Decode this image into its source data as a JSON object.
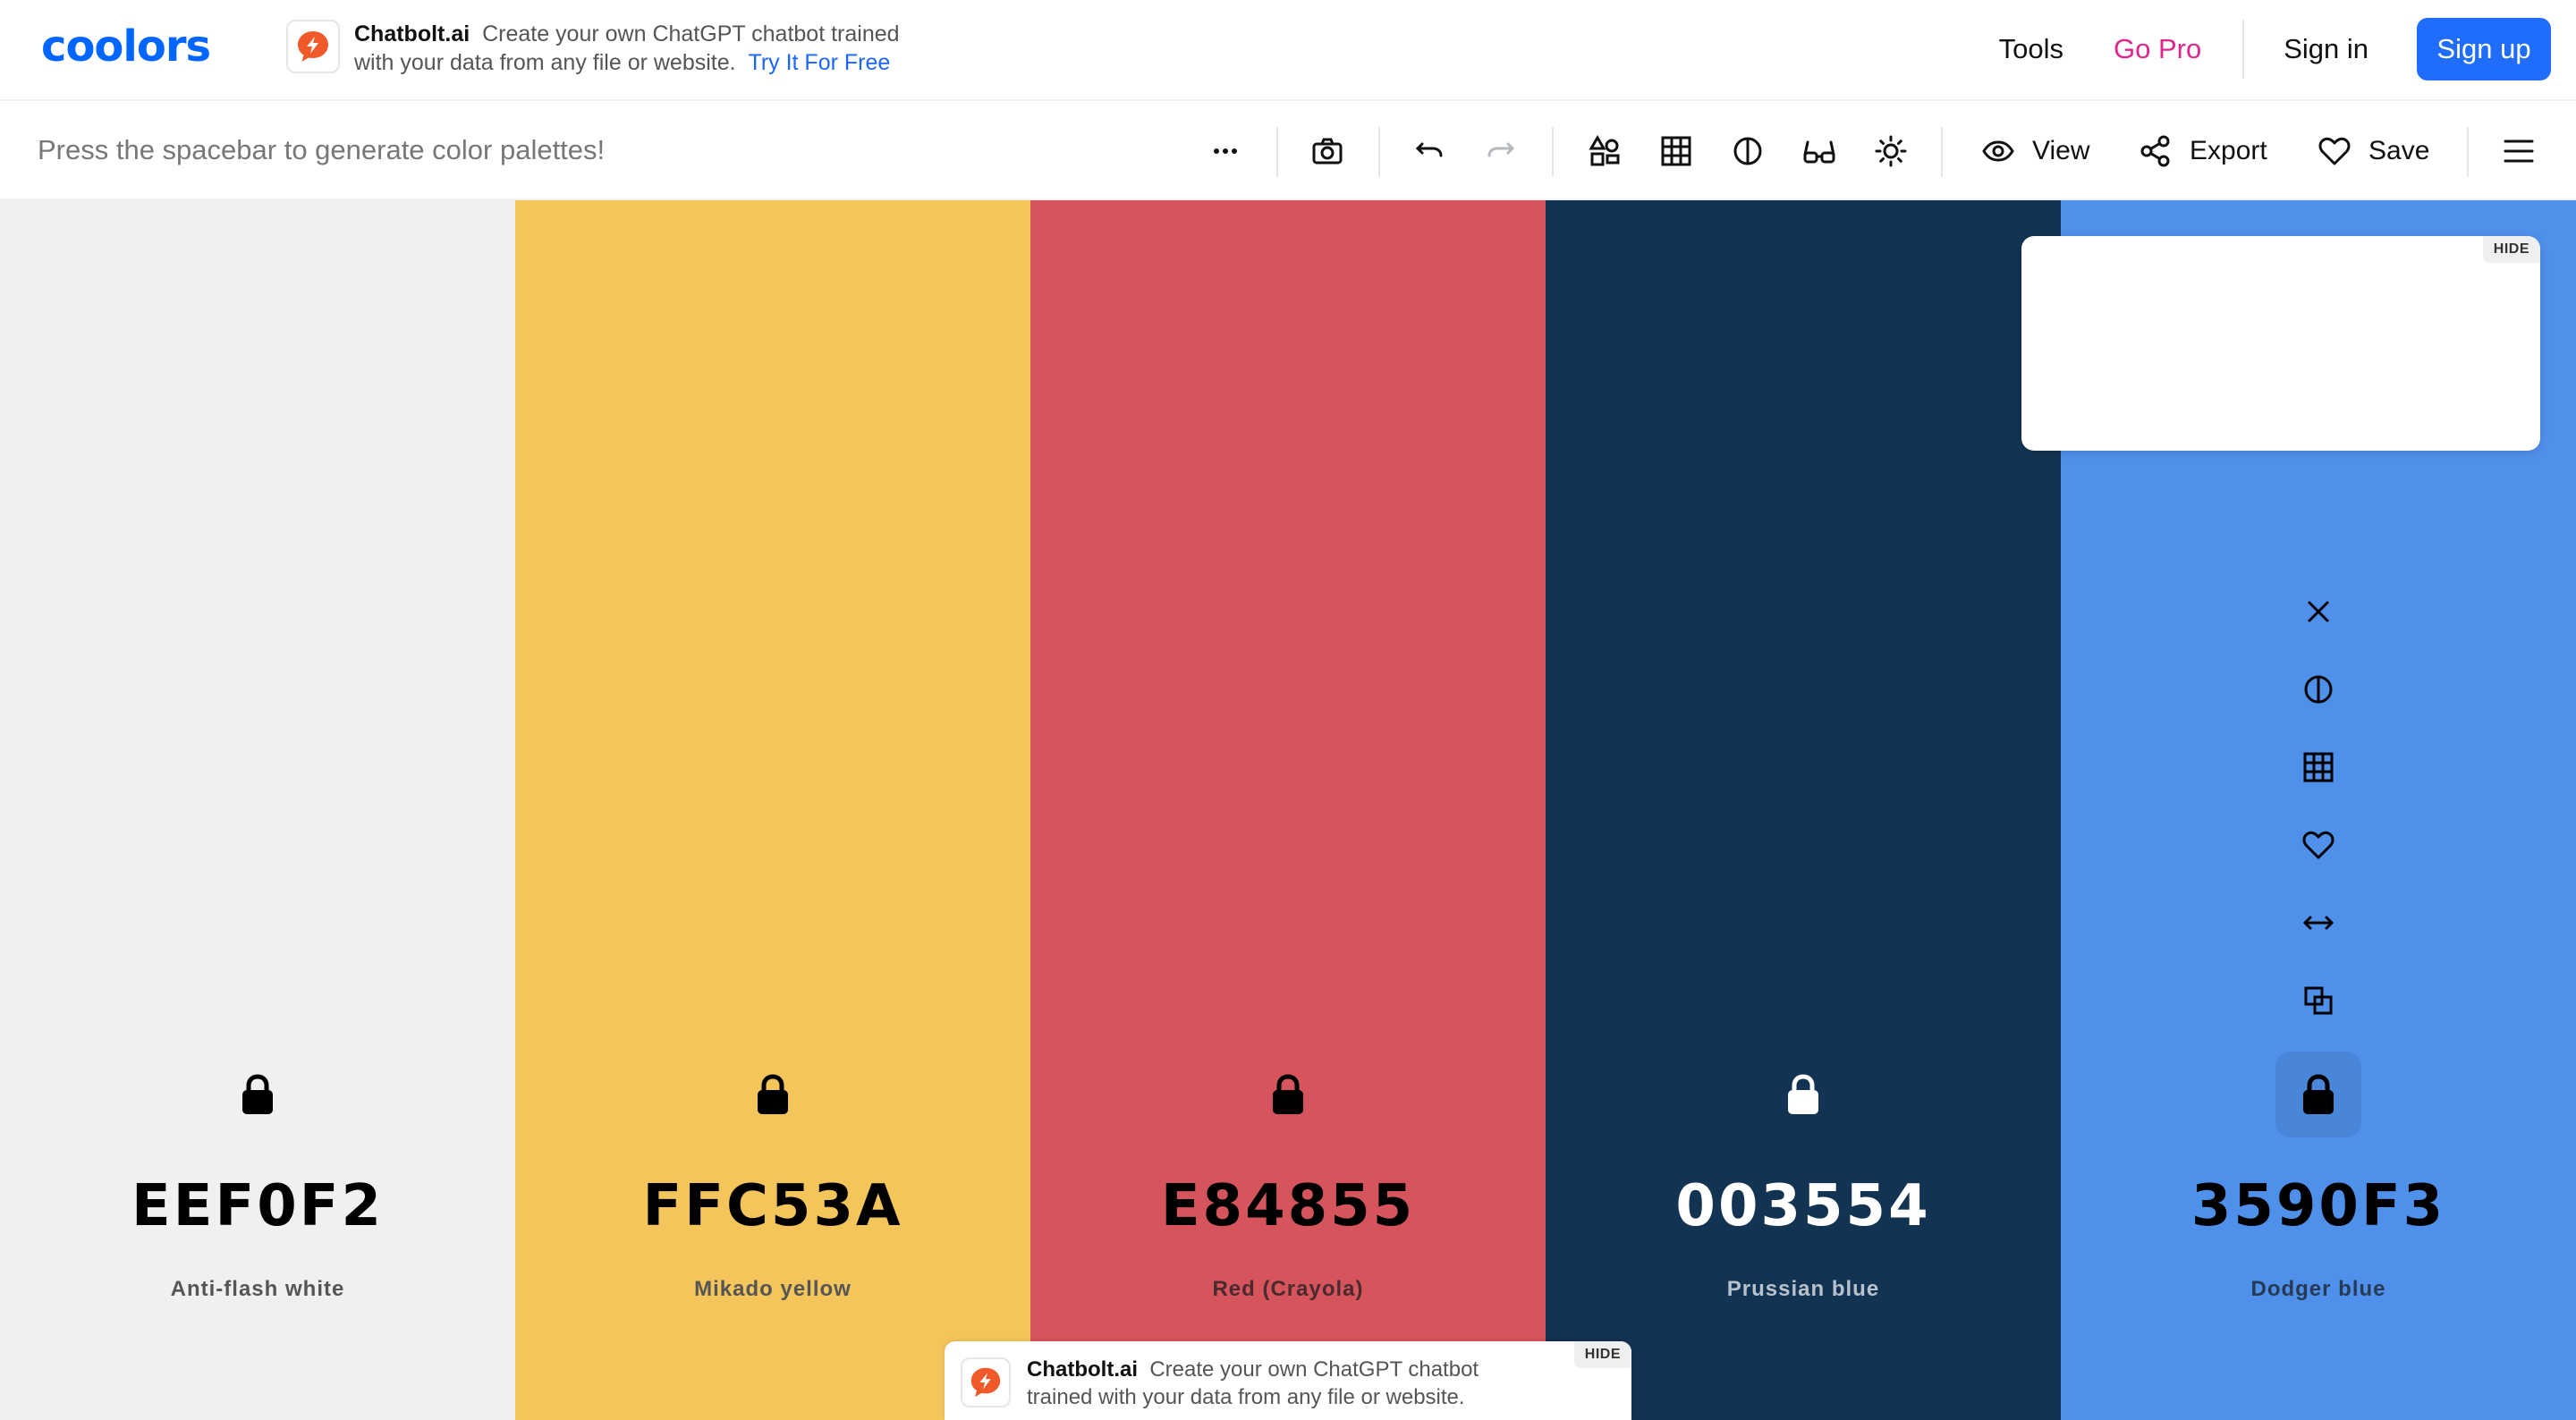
{
  "header": {
    "logo_text": "coolors",
    "ad": {
      "brand": "Chatbolt.ai",
      "line1": "Create your own ChatGPT chatbot trained",
      "line2": "with your data from any file or website.",
      "cta": "Try It For Free"
    },
    "nav": {
      "tools": "Tools",
      "go_pro": "Go Pro",
      "sign_in": "Sign in",
      "sign_up": "Sign up"
    }
  },
  "toolbar": {
    "hint": "Press the spacebar to generate color palettes!",
    "view_label": "View",
    "export_label": "Export",
    "save_label": "Save",
    "icons": [
      "more-icon",
      "camera-icon",
      "undo-icon",
      "redo-icon",
      "shapes-icon",
      "grid-icon",
      "contrast-icon",
      "glasses-icon",
      "brightness-icon",
      "eye-icon",
      "share-icon",
      "heart-icon",
      "menu-icon"
    ]
  },
  "palette": {
    "colors": [
      {
        "hex": "EEF0F2",
        "name": "Anti-flash white",
        "bg": "#EEF0F2",
        "text_color": "#000000",
        "name_color": "#555555",
        "lock_color": "#000000"
      },
      {
        "hex": "FFC53A",
        "name": "Mikado yellow",
        "bg": "#F4C55B",
        "text_color": "#000000",
        "name_color": "#555555",
        "lock_color": "#000000"
      },
      {
        "hex": "E84855",
        "name": "Red (Crayola)",
        "bg": "#D6545C",
        "text_color": "#000000",
        "name_color": "#4a2a2c",
        "lock_color": "#000000"
      },
      {
        "hex": "003554",
        "name": "Prussian blue",
        "bg": "#133352",
        "text_color": "#FFFFFF",
        "name_color": "#b7c2cd",
        "lock_color": "#FFFFFF"
      },
      {
        "hex": "3590F3",
        "name": "Dodger blue",
        "bg": "#4F90EA",
        "text_color": "#000000",
        "name_color": "#263a55",
        "lock_color": "#000000"
      }
    ],
    "hovered_tools": [
      "close-icon",
      "contrast-icon",
      "grid-icon",
      "heart-icon",
      "drag-icon",
      "copy-icon"
    ]
  },
  "ad_card": {
    "hide_label": "HIDE"
  },
  "ad_bottom": {
    "brand": "Chatbolt.ai",
    "line1": "Create your own ChatGPT chatbot",
    "line2": "trained with your data from any file or website.",
    "hide_label": "HIDE"
  }
}
